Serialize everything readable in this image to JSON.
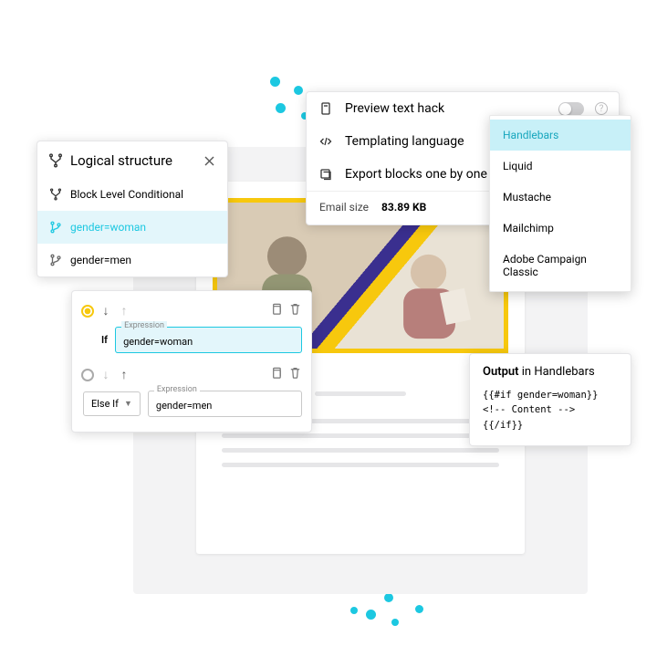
{
  "logical": {
    "title": "Logical structure",
    "block_level": "Block Level Conditional",
    "items": [
      {
        "label": "gender=woman",
        "selected": true
      },
      {
        "label": "gender=men",
        "selected": false
      }
    ]
  },
  "cond": {
    "if_kw": "If",
    "if_expr_label": "Expression",
    "if_expr": "gender=woman",
    "elseif_kw": "Else If",
    "elseif_expr_label": "Expression",
    "elseif_expr": "gender=men"
  },
  "settings": {
    "rows": [
      {
        "label": "Preview text hack"
      },
      {
        "label": "Templating language"
      },
      {
        "label": "Export blocks one by one"
      }
    ],
    "size_label": "Email size",
    "size_value": "83.89 KB"
  },
  "dropdown": {
    "options": [
      "Handlebars",
      "Liquid",
      "Mustache",
      "Mailchimp",
      "Adobe Campaign Classic"
    ],
    "selected": "Handlebars"
  },
  "output": {
    "title_prefix": "Output",
    "title_rest": " in Handlebars",
    "code": "{{#if gender=woman}}\n<!-- Content -->\n{{/if}}"
  }
}
